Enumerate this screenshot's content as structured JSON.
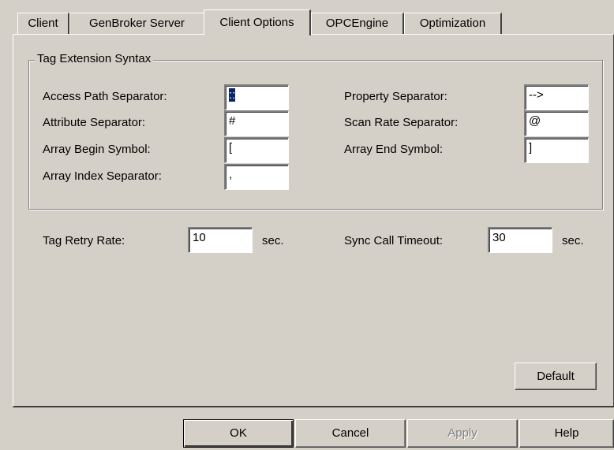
{
  "tabs": [
    "Client",
    "GenBroker Server",
    "Client Options",
    "OPCEngine",
    "Optimization"
  ],
  "active_tab": "Client Options",
  "group": {
    "title": "Tag Extension Syntax",
    "access_path_separator": {
      "label": "Access Path Separator:",
      "value": "::"
    },
    "attribute_separator": {
      "label": "Attribute Separator:",
      "value": "#"
    },
    "array_begin_symbol": {
      "label": "Array Begin Symbol:",
      "value": "["
    },
    "array_index_separator": {
      "label": "Array Index Separator:",
      "value": ","
    },
    "property_separator": {
      "label": "Property Separator:",
      "value": "-->"
    },
    "scan_rate_separator": {
      "label": "Scan Rate Separator:",
      "value": "@"
    },
    "array_end_symbol": {
      "label": "Array End Symbol:",
      "value": "]"
    }
  },
  "tag_retry_rate": {
    "label": "Tag Retry Rate:",
    "value": "10",
    "unit": "sec."
  },
  "sync_call_timeout": {
    "label": "Sync Call Timeout:",
    "value": "30",
    "unit": "sec."
  },
  "default_button": "Default",
  "buttons": {
    "ok": "OK",
    "cancel": "Cancel",
    "apply": "Apply",
    "help": "Help"
  },
  "colors": {
    "face": "#d4d0c8",
    "selection": "#0a246a"
  }
}
